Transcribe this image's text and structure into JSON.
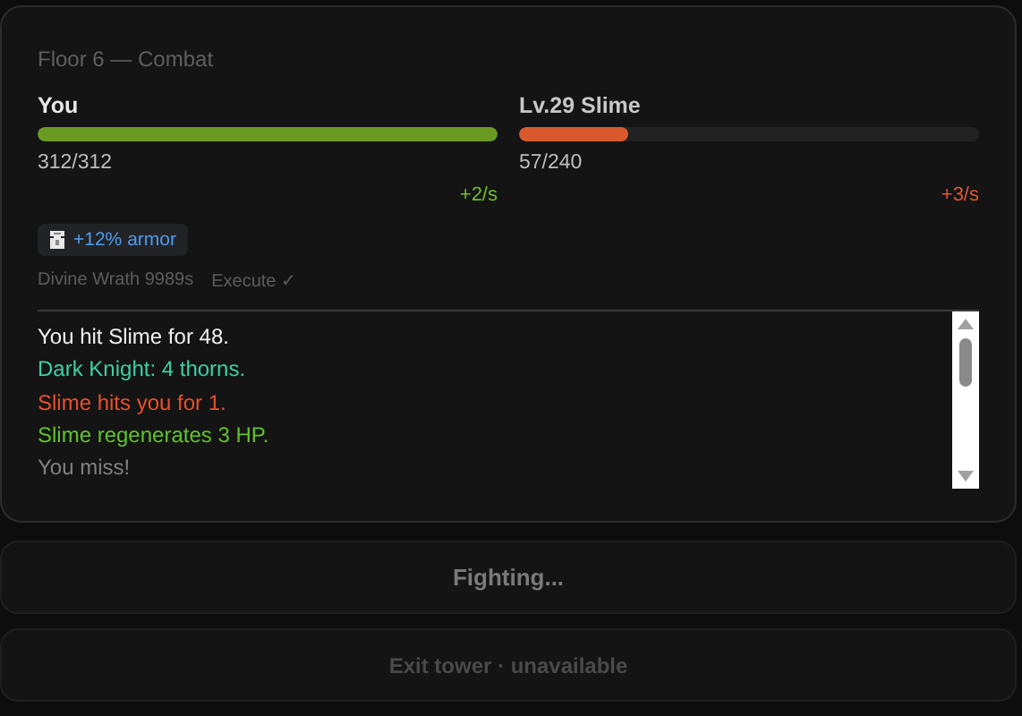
{
  "panel": {
    "title": "Floor 6 — Combat"
  },
  "fighters": [
    {
      "name": "You",
      "kind": "player",
      "level": 1,
      "hp": "312/312",
      "regen": "+2/s"
    },
    {
      "name": "Lv.29 Slime",
      "kind": "enemy",
      "level": 0.2375,
      "hp": "57/240",
      "regen": "+3/s"
    }
  ],
  "buffs": [
    {
      "label": "+12% armor"
    }
  ],
  "skills": [
    {
      "label": "Divine Wrath 9989s"
    },
    {
      "label": "Execute ✓"
    }
  ],
  "log": [
    {
      "text": "You hit Slime for 48.",
      "kind": "player"
    },
    {
      "text": "Dark Knight: 4 thorns.",
      "kind": "ally"
    },
    {
      "text": "Slime hits you for 1.",
      "kind": "enemy"
    },
    {
      "text": "Slime regenerates 3 HP.",
      "kind": "heal"
    },
    {
      "text": "You miss!",
      "kind": "miss"
    }
  ],
  "buttons": [
    {
      "label": "Fighting...",
      "kind": "primary",
      "disabled": true
    },
    {
      "label": "Exit tower · unavailable",
      "kind": "secondary",
      "disabled": true
    }
  ]
}
